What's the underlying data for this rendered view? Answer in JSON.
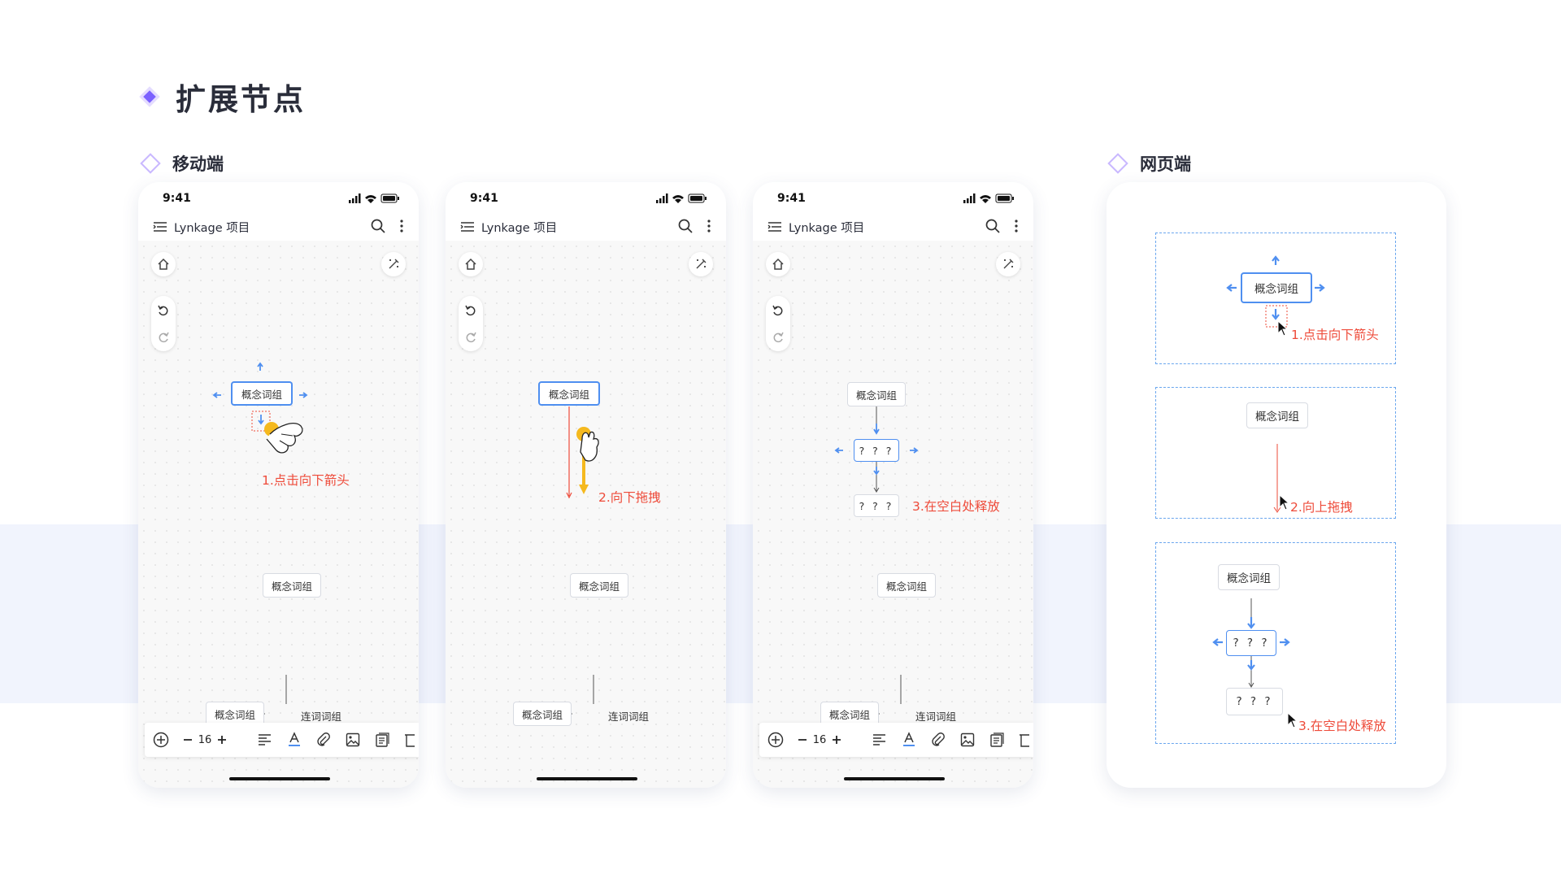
{
  "page": {
    "title": "扩展节点",
    "mobile_section": "移动端",
    "web_section": "网页端"
  },
  "phones": [
    {
      "time": "9:41",
      "project": "Lynkage 项目",
      "node_main": "概念词组",
      "step": "1.点击向下箭头",
      "bottom_node_top": "概念词组",
      "bottom_node_left": "概念词组",
      "bottom_link": "连词词组",
      "font_size": "16"
    },
    {
      "time": "9:41",
      "project": "Lynkage 项目",
      "node_main": "概念词组",
      "step": "2.向下拖拽",
      "bottom_node_top": "概念词组",
      "bottom_node_left": "概念词组",
      "bottom_link": "连词词组"
    },
    {
      "time": "9:41",
      "project": "Lynkage 项目",
      "node_main": "概念词组",
      "node_new": "? ? ?",
      "node_new2": "? ? ?",
      "step": "3.在空白处释放",
      "bottom_node_top": "概念词组",
      "bottom_node_left": "概念词组",
      "bottom_link": "连词词组",
      "font_size": "16"
    }
  ],
  "web": {
    "panel1": {
      "node": "概念词组",
      "step": "1.点击向下箭头"
    },
    "panel2": {
      "node": "概念词组",
      "step": "2.向上拖拽"
    },
    "panel3": {
      "node": "概念词组",
      "node_new": "? ? ?",
      "node_new2": "? ? ?",
      "step": "3.在空白处释放"
    }
  },
  "colors": {
    "accent_purple": "#7b61ff",
    "arrow_blue": "#4f8ff0",
    "step_red": "#ee4b3a",
    "drag_yellow": "#f5b91e"
  },
  "icons": [
    "menu-icon",
    "search-icon",
    "more-icon",
    "home-icon",
    "magic-icon",
    "undo-icon",
    "redo-icon",
    "add-icon",
    "align-icon",
    "text-color-icon",
    "attach-icon",
    "image-icon",
    "note-icon",
    "delete-icon",
    "cursor-icon",
    "hand-pointer-icon"
  ]
}
